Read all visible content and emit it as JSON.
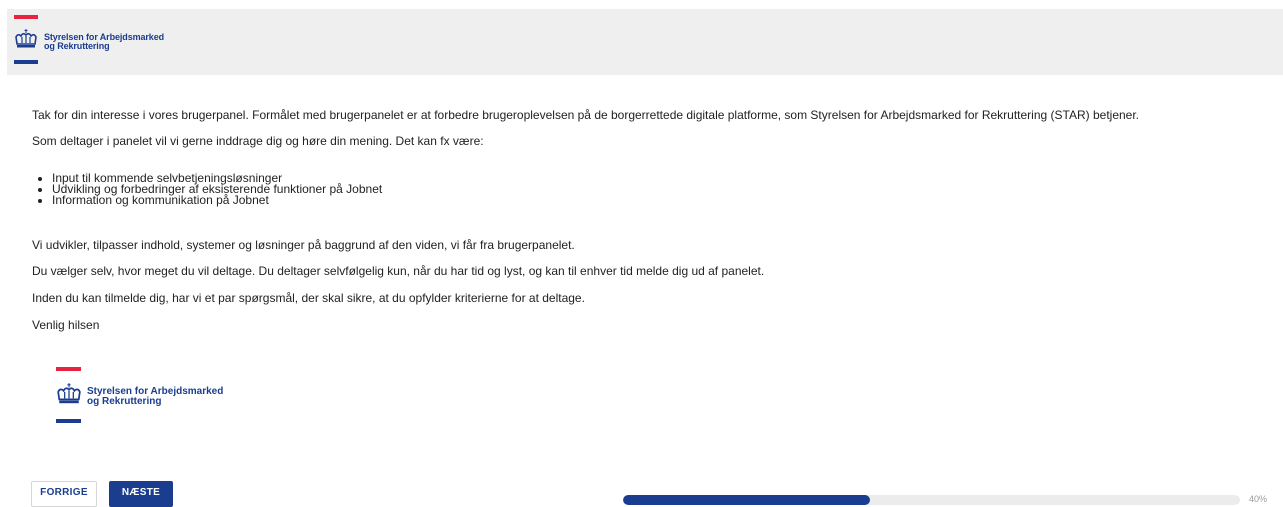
{
  "header": {
    "logo": {
      "line1": "Styrelsen for Arbejdsmarked",
      "line2": "og Rekruttering"
    }
  },
  "content": {
    "intro": "Tak for din interesse i vores brugerpanel. Formålet med brugerpanelet er at forbedre brugeroplevelsen på de borgerrettede digitale platforme, som Styrelsen for Arbejdsmarked for Rekruttering (STAR) betjener.",
    "panel_intro": "Som deltager i panelet vil vi gerne inddrage dig og høre din mening. Det kan fx være:",
    "list": [
      "Input til kommende selvbetjeningsløsninger",
      "Udvikling og forbedringer af eksisterende funktioner på Jobnet",
      "Information og kommunikation på Jobnet"
    ],
    "develop": "Vi udvikler, tilpasser indhold, systemer og løsninger på baggrund af den viden, vi får fra brugerpanelet.",
    "choose": "Du vælger selv, hvor meget du vil deltage. Du deltager selvfølgelig kun, når du har tid og lyst, og kan til enhver tid melde dig ud af panelet.",
    "before": "Inden du kan tilmelde dig, har vi et par spørgsmål, der skal sikre, at du opfylder kriterierne for at deltage.",
    "signoff": "Venlig hilsen"
  },
  "footer_logo": {
    "line1": "Styrelsen for Arbejdsmarked",
    "line2": "og Rekruttering"
  },
  "nav": {
    "prev_label": "FORRIGE",
    "next_label": "NÆSTE"
  },
  "progress": {
    "value": 0.4,
    "label": "40%"
  },
  "colors": {
    "brand_blue": "#1a3d8f",
    "brand_red": "#e8233f",
    "header_bg": "#efefef"
  }
}
